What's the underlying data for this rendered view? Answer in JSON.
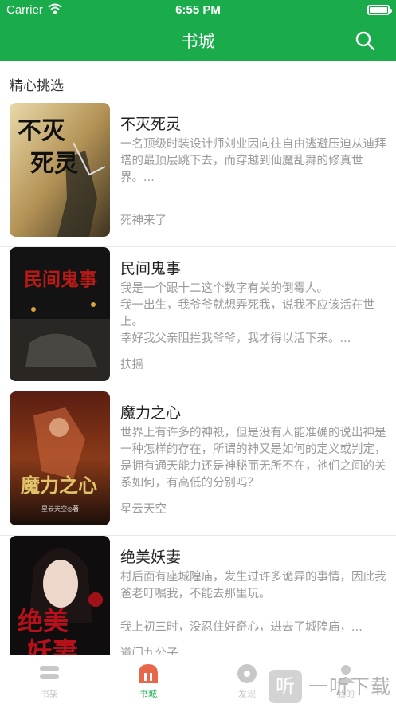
{
  "status_bar": {
    "carrier": "Carrier",
    "time": "6:55 PM"
  },
  "header": {
    "title": "书城",
    "search_icon": "search-icon"
  },
  "colors": {
    "brand": "#1aac4b",
    "muted_text": "#9a9a9a",
    "title_text": "#222222"
  },
  "section": {
    "title": "精心挑选"
  },
  "books": [
    {
      "title": "不灭死灵",
      "desc": "    一名顶级时装设计师刘业因向往自由逃避压迫从迪拜塔的最顶层跳下去，而穿越到仙魔乱舞的修真世界。...",
      "author": "死神来了",
      "cover_text": "不灭死灵"
    },
    {
      "title": "民间鬼事",
      "desc": "我是一个跟十二这个数字有关的倒霉人。\n我一出生，我爷爷就想弄死我，说我不应该活在世上。\n幸好我父亲阻拦我爷爷，我才得以活下来。...",
      "author": "扶摇",
      "cover_text": "民间鬼事"
    },
    {
      "title": "魔力之心",
      "desc": "    世界上有许多的神祇，但是没有人能准确的说出神是一种怎样的存在，所谓的神又是如何的定义或判定，是拥有通天能力还是神秘而无所不在，祂们之间的关系如何，有高低的分别吗？",
      "author": "星云天空",
      "cover_text": "魔力之心",
      "cover_caption": "星云天空◎著"
    },
    {
      "title": "绝美妖妻",
      "desc": "村后面有座城隍庙，发生过许多诡异的事情，因此我爸老叮嘱我，不能去那里玩。\n\n我上初三时，没忍住好奇心，进去了城隍庙，...",
      "author": "道门九公子",
      "cover_text": "绝美妖妻"
    }
  ],
  "tabbar": {
    "tabs": [
      {
        "label": "书架",
        "icon": "bookshelf-icon"
      },
      {
        "label": "书城",
        "icon": "bookstore-icon",
        "active": true
      },
      {
        "label": "发现",
        "icon": "discover-icon"
      },
      {
        "label": "我的",
        "icon": "profile-icon"
      }
    ]
  },
  "watermark": {
    "badge": "听",
    "text": "一听下载"
  }
}
